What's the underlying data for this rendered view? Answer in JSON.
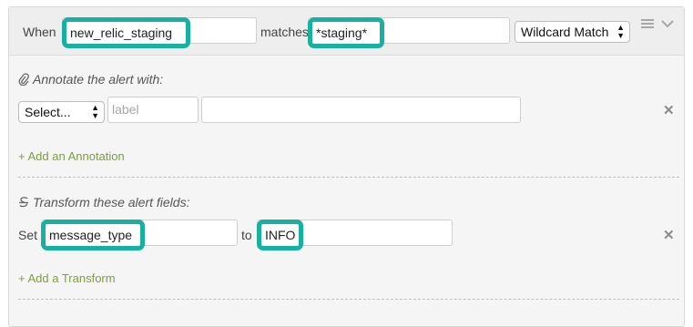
{
  "condition": {
    "when_label": "When",
    "field_value": "new_relic_staging",
    "matches_label": "matches",
    "pattern_value": "*staging*",
    "match_type": "Wildcard Match"
  },
  "annotate": {
    "title": "Annotate the alert with:",
    "select_value": "Select...",
    "label_placeholder": "label",
    "value_text": "",
    "add_link": "+ Add an Annotation"
  },
  "transform": {
    "title": "Transform these alert fields:",
    "set_label": "Set",
    "field_value": "message_type",
    "to_label": "to",
    "to_value": "INFO",
    "add_link": "+ Add a Transform"
  },
  "icons": {
    "menu": "hamburger-menu-icon",
    "collapse": "chevron-down-icon",
    "attach": "paperclip-icon",
    "transform": "strikethrough-icon",
    "remove": "close-icon"
  },
  "colors": {
    "highlight": "#18b0a0",
    "link": "#7aa13a"
  }
}
